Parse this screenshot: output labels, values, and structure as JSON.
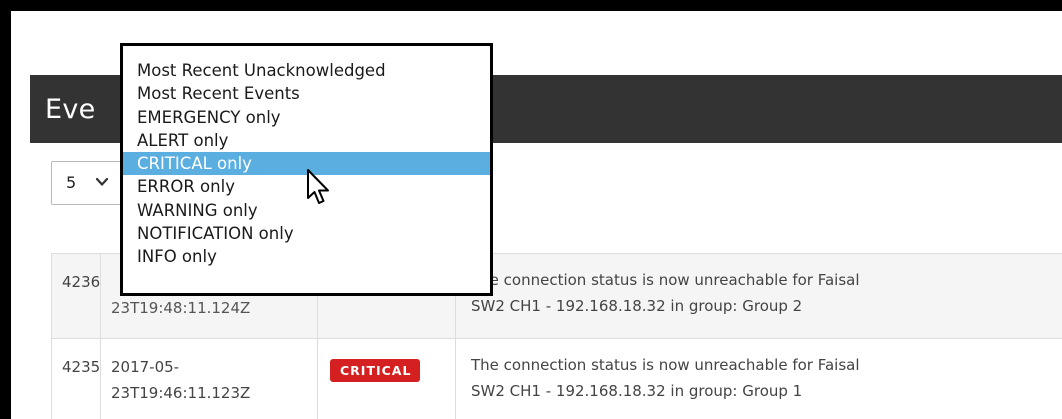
{
  "panel": {
    "title": "Eve"
  },
  "page_size": {
    "value": "5"
  },
  "filter_dropdown": {
    "options": [
      "Most Recent Unacknowledged",
      "Most Recent Events",
      "EMERGENCY only",
      "ALERT only",
      "CRITICAL only",
      "ERROR only",
      "WARNING only",
      "NOTIFICATION only",
      "INFO only"
    ],
    "selected": "CRITICAL only"
  },
  "events": [
    {
      "id": "4236",
      "timestamp_visible": "23T19:48:11.124Z",
      "severity": "",
      "message": "The connection status is now unreachable for Faisal\nSW2 CH1 - 192.168.18.32 in group: Group 2"
    },
    {
      "id": "4235",
      "timestamp": "2017-05-\n23T19:46:11.123Z",
      "severity": "CRITICAL",
      "message": "The connection status is now unreachable for Faisal\nSW2 CH1 - 192.168.18.32 in group: Group 1"
    }
  ],
  "colors": {
    "header_bg": "#333333",
    "critical_badge": "#d42020",
    "selected_option": "#5aaee0"
  }
}
